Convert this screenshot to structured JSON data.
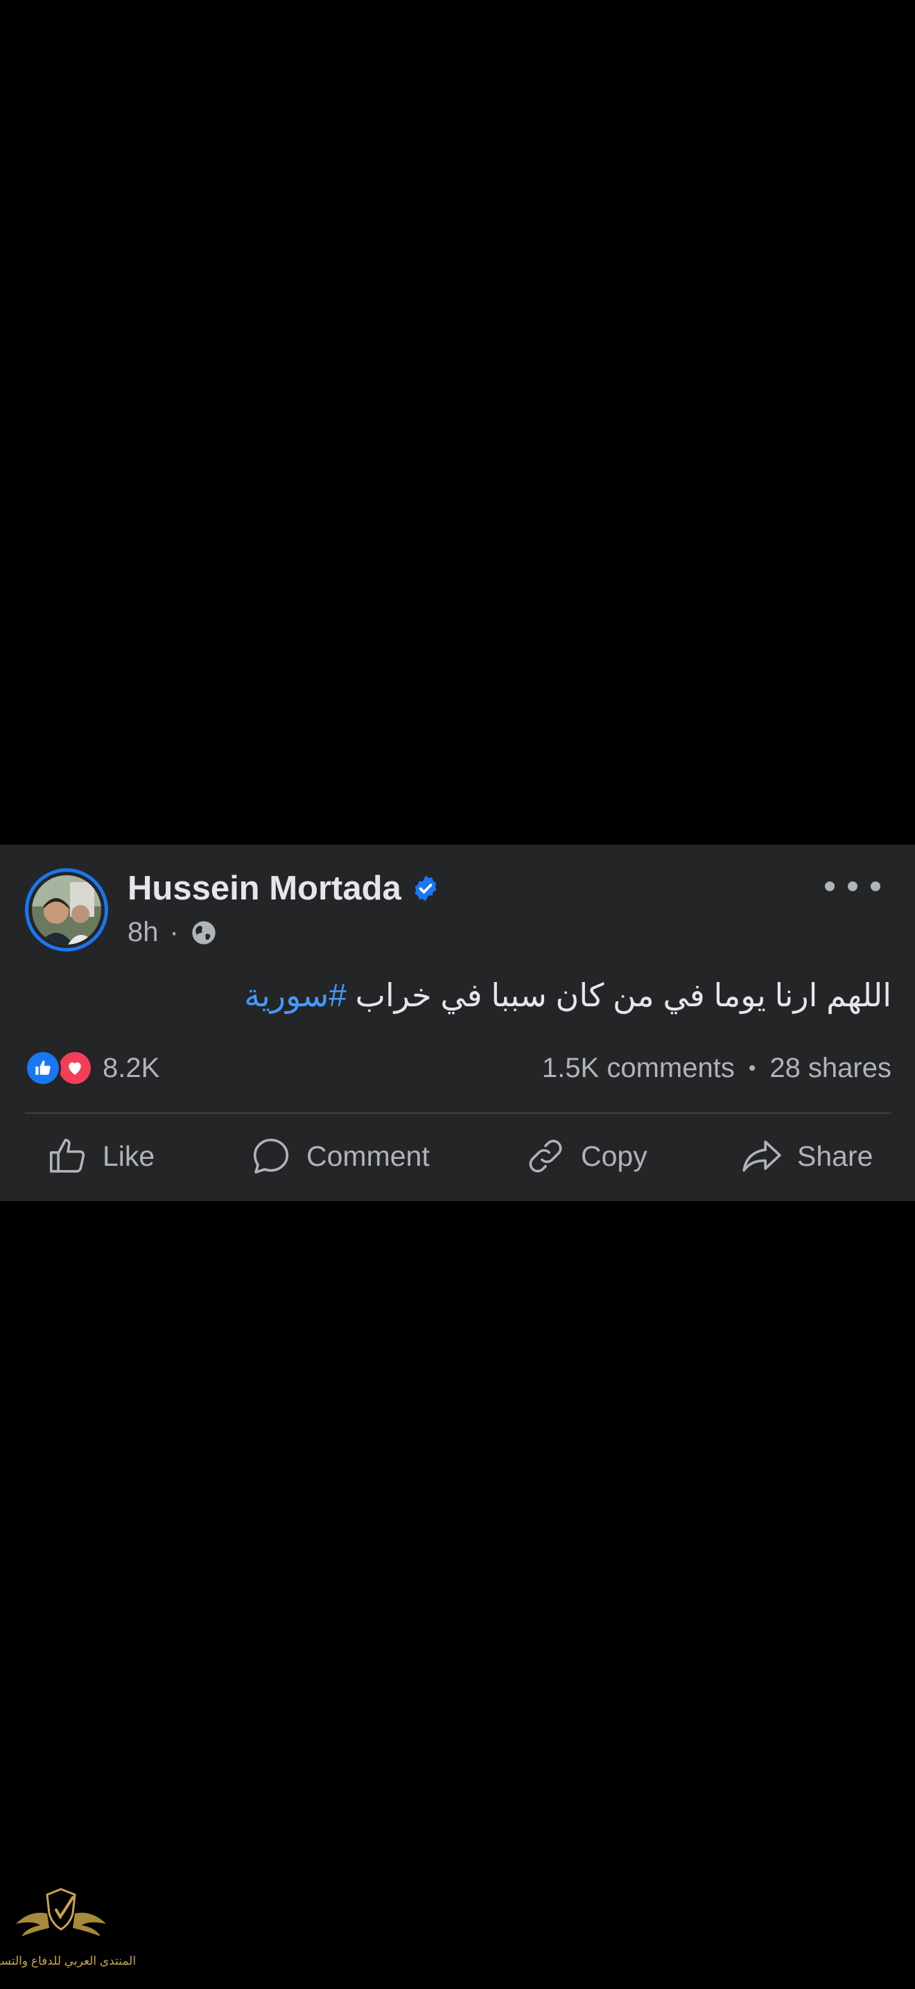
{
  "post": {
    "author": "Hussein Mortada",
    "time": "8h",
    "meta_separator": "·",
    "text": "اللهم ارنا يوما في من كان سببا في خراب",
    "hashtag": "#سورية",
    "reactions_count": "8.2K",
    "comments": "1.5K comments",
    "stats_separator": "•",
    "shares": "28 shares"
  },
  "actions": {
    "like": "Like",
    "comment": "Comment",
    "copy": "Copy",
    "share": "Share"
  },
  "watermark": {
    "text": "المنتدى العربي للدفاع والتسليح"
  },
  "icons": {
    "verified": "verified-badge-icon",
    "privacy": "globe-icon",
    "more": "more-options-icon",
    "like_reaction": "like-reaction-icon",
    "love_reaction": "love-reaction-icon",
    "like_action": "thumbs-up-icon",
    "comment_action": "comment-bubble-icon",
    "copy_action": "link-icon",
    "share_action": "share-arrow-icon"
  },
  "colors": {
    "background": "#000000",
    "card": "#242526",
    "accent": "#1877f2",
    "hashtag": "#4599ff",
    "love": "#f33e58",
    "primary_text": "#e4e6eb",
    "secondary_text": "#b0b3b8"
  }
}
